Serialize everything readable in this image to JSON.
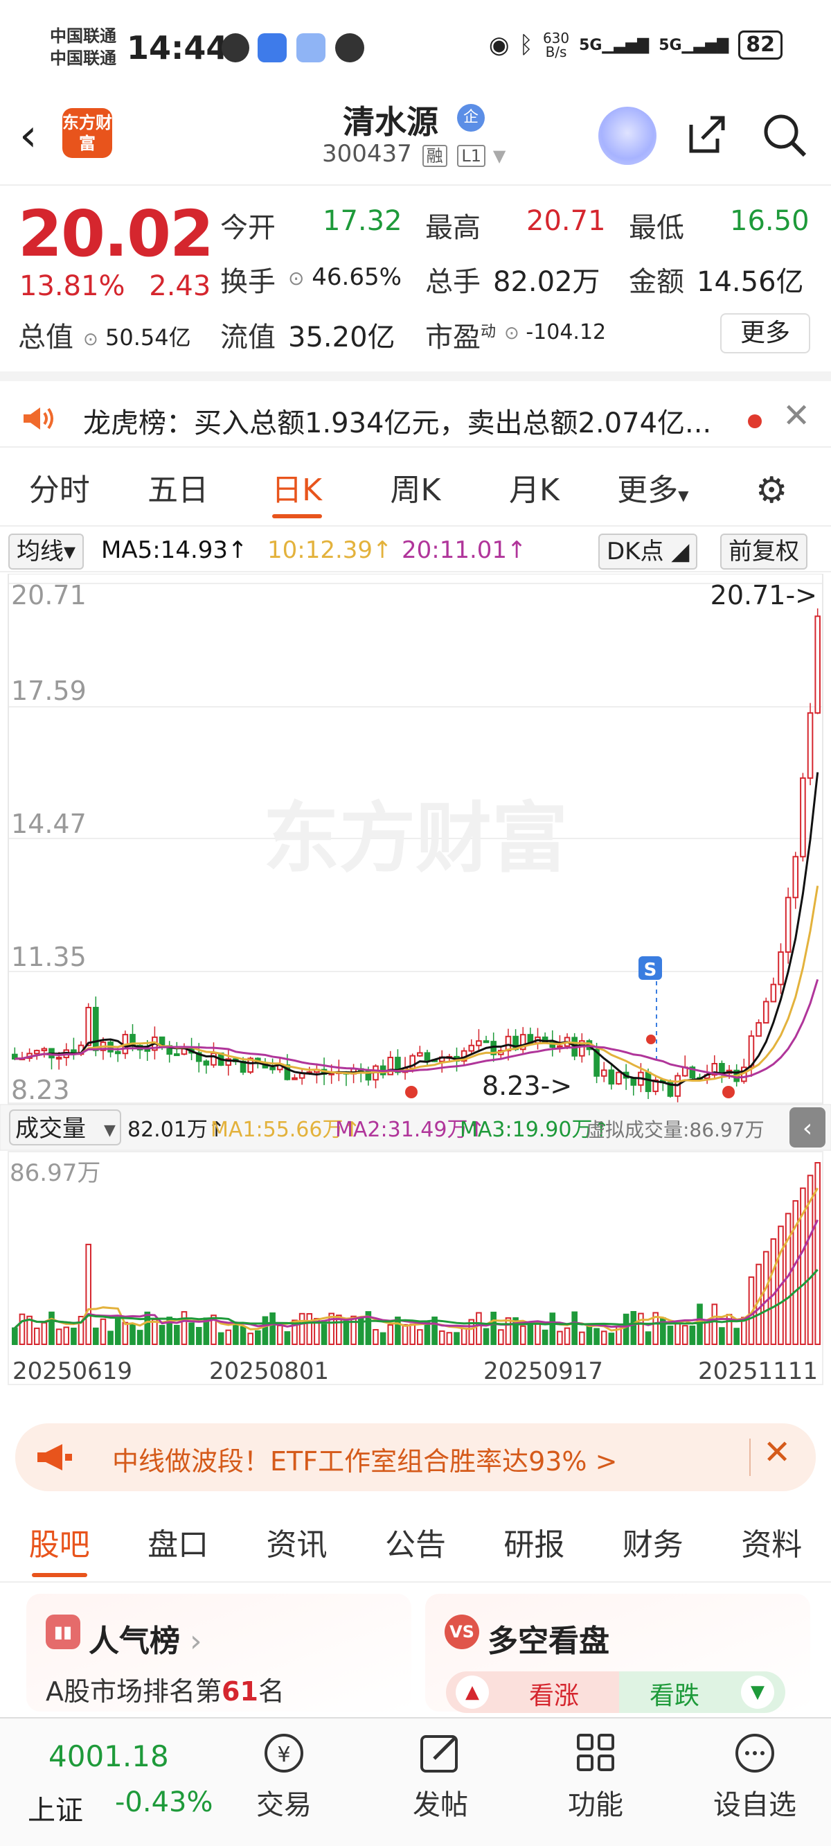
{
  "status_bar": {
    "carrier1": "中国联通",
    "carrier2": "中国联通",
    "time": "14:44",
    "net_speed_top": "630",
    "net_speed_bottom": "B/s",
    "signal1": "5G",
    "signal2": "5G",
    "battery": "82"
  },
  "header": {
    "logo_text": "东方财富",
    "stock_name": "清水源",
    "badge": "企",
    "stock_code": "300437",
    "tag1": "融",
    "tag2": "L1"
  },
  "quote": {
    "price": "20.02",
    "change_pct": "13.81%",
    "change_abs": "2.43",
    "open_label": "今开",
    "open_value": "17.32",
    "high_label": "最高",
    "high_value": "20.71",
    "low_label": "最低",
    "low_value": "16.50",
    "turnover_label": "换手",
    "turnover_value": "46.65%",
    "volume_label": "总手",
    "volume_value": "82.02万",
    "amount_label": "金额",
    "amount_value": "14.56亿",
    "mktcap_label": "总值",
    "mktcap_value": "50.54亿",
    "float_label": "流值",
    "float_value": "35.20亿",
    "pe_label": "市盈",
    "pe_sup": "动",
    "pe_value": "-104.12",
    "more": "更多"
  },
  "dragon_tiger": {
    "text": "龙虎榜：买入总额1.934亿元，卖出总额2.074亿..."
  },
  "period_tabs": [
    "分时",
    "五日",
    "日K",
    "周K",
    "月K",
    "更多"
  ],
  "ma_bar": {
    "selector": "均线",
    "ma5": "MA5:14.93↑",
    "ma10": "10:12.39↑",
    "ma20": "20:11.01↑",
    "dk": "DK点",
    "adjust": "前复权"
  },
  "kline_axis": {
    "y_labels": [
      "20.71",
      "17.59",
      "14.47",
      "11.35",
      "8.23"
    ],
    "high_marker": "20.71->",
    "low_marker": "8.23->",
    "watermark": "东方财富",
    "x_labels": [
      "20250619",
      "20250801",
      "20250917",
      "20251111"
    ]
  },
  "volume_bar": {
    "selector": "成交量",
    "vol": "82.01万↑",
    "ma1": "MA1:55.66万↑",
    "ma2": "MA2:31.49万↑",
    "ma3": "MA3:19.90万↑",
    "virtual": "虚拟成交量:86.97万",
    "max_label": "86.97万"
  },
  "ad": {
    "text": "中线做波段！ETF工作室组合胜率达93% >"
  },
  "info_tabs": [
    "股吧",
    "盘口",
    "资讯",
    "公告",
    "研报",
    "财务",
    "资料"
  ],
  "cards": {
    "popular_title": "人气榜",
    "popular_text_prefix": "A股市场排名第",
    "popular_rank": "61",
    "popular_text_suffix": "名",
    "duokong_title": "多空看盘",
    "bull": "看涨",
    "bear": "看跌"
  },
  "bottom_nav": {
    "index_value": "4001.18",
    "index_name": "上证",
    "index_change": "-0.43%",
    "items": [
      "交易",
      "发帖",
      "功能",
      "设自选"
    ]
  },
  "colors": {
    "up": "#d5262e",
    "down": "#1e9a3a",
    "accent": "#e8541c",
    "ma5": "#111111",
    "ma10": "#e3b23c",
    "ma20": "#b0359a"
  }
}
